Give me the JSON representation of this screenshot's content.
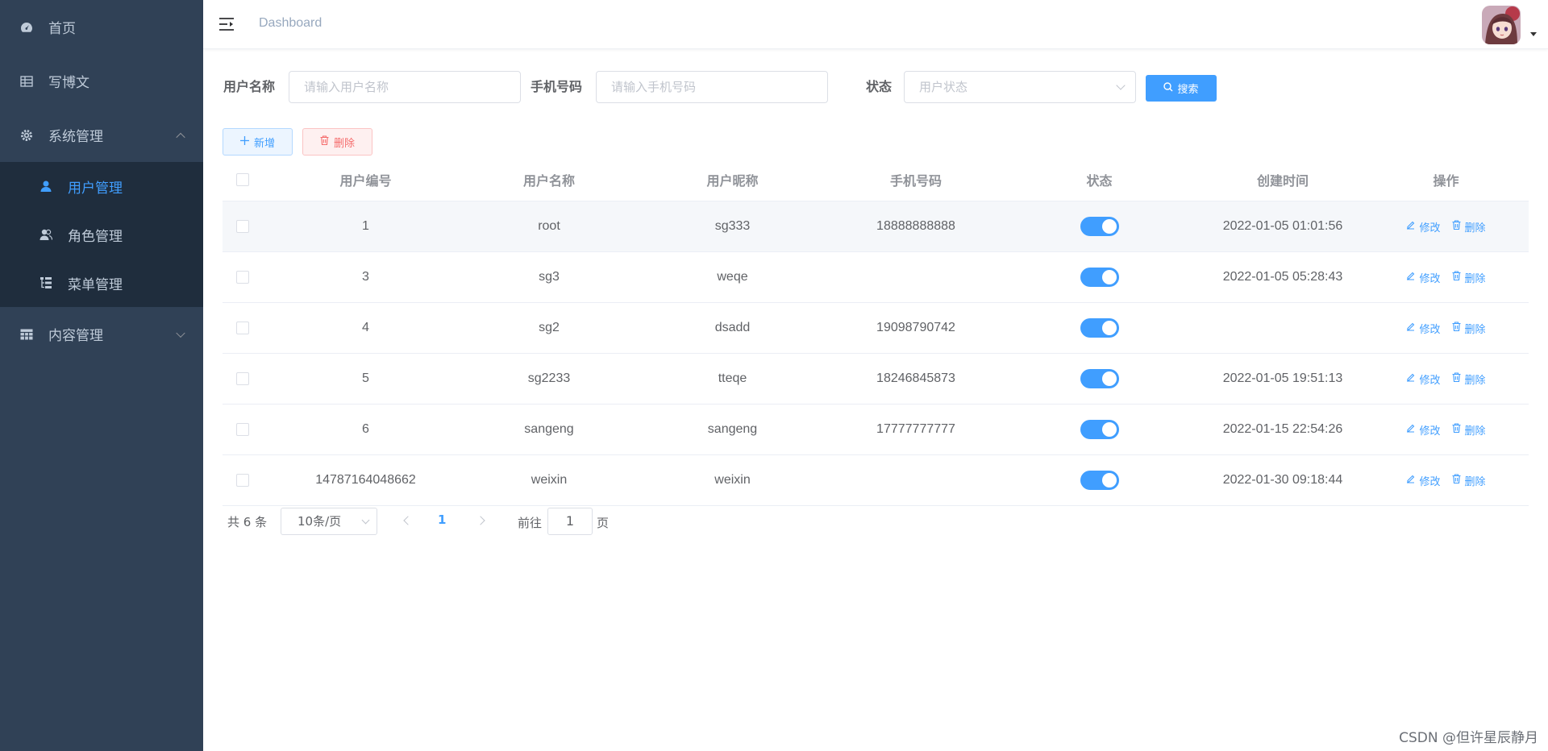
{
  "sidebar": {
    "items": [
      {
        "label": "首页",
        "icon": "dashboard-icon"
      },
      {
        "label": "写博文",
        "icon": "table-icon"
      },
      {
        "label": "系统管理",
        "icon": "gear-icon",
        "expanded": true,
        "children": [
          {
            "label": "用户管理",
            "icon": "user-icon",
            "active": true
          },
          {
            "label": "角色管理",
            "icon": "peoples-icon"
          },
          {
            "label": "菜单管理",
            "icon": "tree-table-icon"
          }
        ]
      },
      {
        "label": "内容管理",
        "icon": "grid-icon",
        "expanded": false
      }
    ]
  },
  "header": {
    "breadcrumb": "Dashboard",
    "hamburger_icon": "hamburger-icon",
    "avatar_icon": "avatar-image"
  },
  "search": {
    "username_label": "用户名称",
    "username_placeholder": "请输入用户名称",
    "phone_label": "手机号码",
    "phone_placeholder": "请输入手机号码",
    "status_label": "状态",
    "status_placeholder": "用户状态",
    "search_button": "搜索"
  },
  "toolbar": {
    "add_label": "新增",
    "delete_label": "删除"
  },
  "table": {
    "columns": [
      "用户编号",
      "用户名称",
      "用户昵称",
      "手机号码",
      "状态",
      "创建时间",
      "操作"
    ],
    "rows": [
      {
        "id": "1",
        "name": "root",
        "nick": "sg333",
        "phone": "18888888888",
        "status": true,
        "time": "2022-01-05 01:01:56"
      },
      {
        "id": "3",
        "name": "sg3",
        "nick": "weqe",
        "phone": "",
        "status": true,
        "time": "2022-01-05 05:28:43"
      },
      {
        "id": "4",
        "name": "sg2",
        "nick": "dsadd",
        "phone": "19098790742",
        "status": true,
        "time": ""
      },
      {
        "id": "5",
        "name": "sg2233",
        "nick": "tteqe",
        "phone": "18246845873",
        "status": true,
        "time": "2022-01-05 19:51:13"
      },
      {
        "id": "6",
        "name": "sangeng",
        "nick": "sangeng",
        "phone": "17777777777",
        "status": true,
        "time": "2022-01-15 22:54:26"
      },
      {
        "id": "14787164048662",
        "name": "weixin",
        "nick": "weixin",
        "phone": "",
        "status": true,
        "time": "2022-01-30 09:18:44"
      }
    ],
    "edit_label": "修改",
    "delete_label": "删除"
  },
  "pagination": {
    "total_text": "共 6 条",
    "page_size": "10条/页",
    "current_page": "1",
    "goto_label": "前往",
    "goto_value": "1",
    "page_unit": "页"
  },
  "watermark": "CSDN @但许星辰静月",
  "colors": {
    "sidebar_bg": "#304156",
    "submenu_bg": "#1f2d3d",
    "primary": "#409eff",
    "danger": "#f56c6c"
  }
}
